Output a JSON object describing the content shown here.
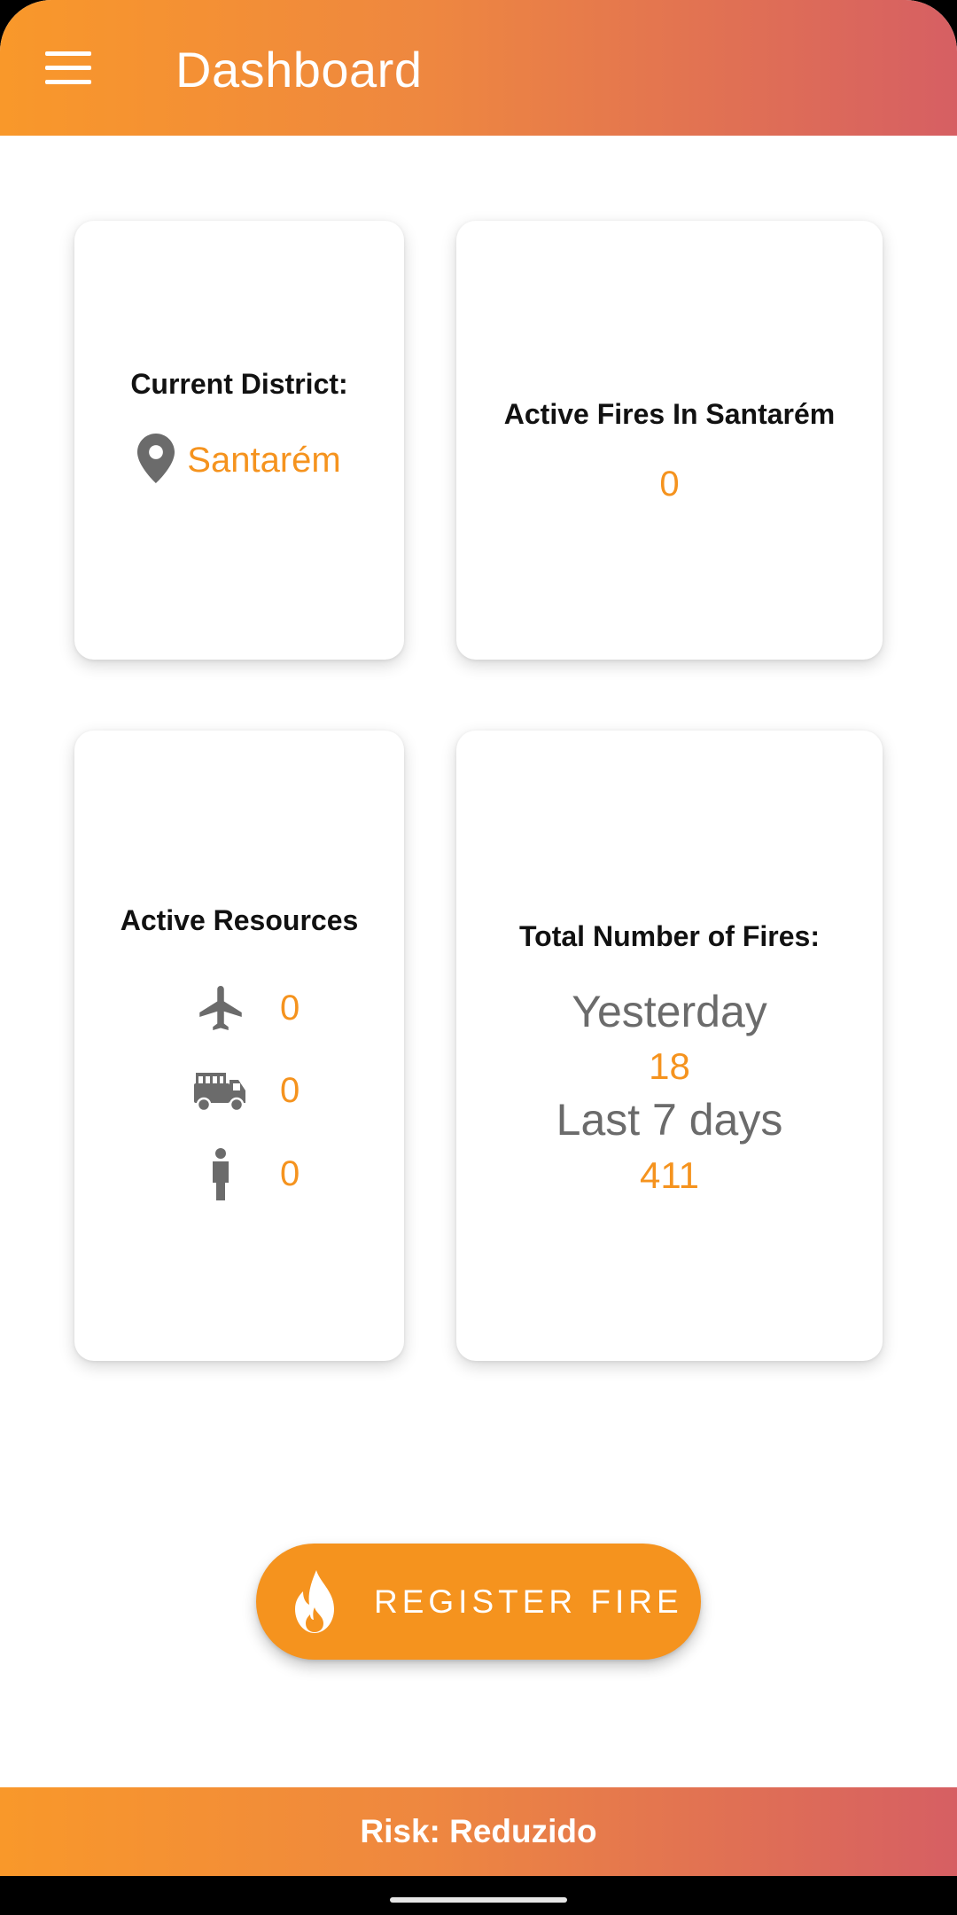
{
  "appbar": {
    "title": "Dashboard",
    "menu_icon": "hamburger-menu-icon"
  },
  "cards": {
    "district": {
      "title": "Current District:",
      "icon": "location-pin-icon",
      "value": "Santarém"
    },
    "active_fires": {
      "title": "Active Fires In Santarém",
      "value": "0"
    },
    "resources": {
      "title": "Active Resources",
      "items": [
        {
          "icon": "airplane-icon",
          "value": "0"
        },
        {
          "icon": "fire-truck-icon",
          "value": "0"
        },
        {
          "icon": "person-icon",
          "value": "0"
        }
      ]
    },
    "total_fires": {
      "title": "Total Number of Fires:",
      "yesterday_label": "Yesterday",
      "yesterday_value": "18",
      "week_label": "Last 7 days",
      "week_value": "411"
    }
  },
  "register_button": {
    "label": "REGISTER FIRE",
    "icon": "flame-icon"
  },
  "risk": {
    "text": "Risk: Reduzido"
  },
  "colors": {
    "accent": "#F5931E",
    "gradient_start": "#F9982A",
    "gradient_end": "#D65F63",
    "icon_grey": "#6b6b6b"
  }
}
